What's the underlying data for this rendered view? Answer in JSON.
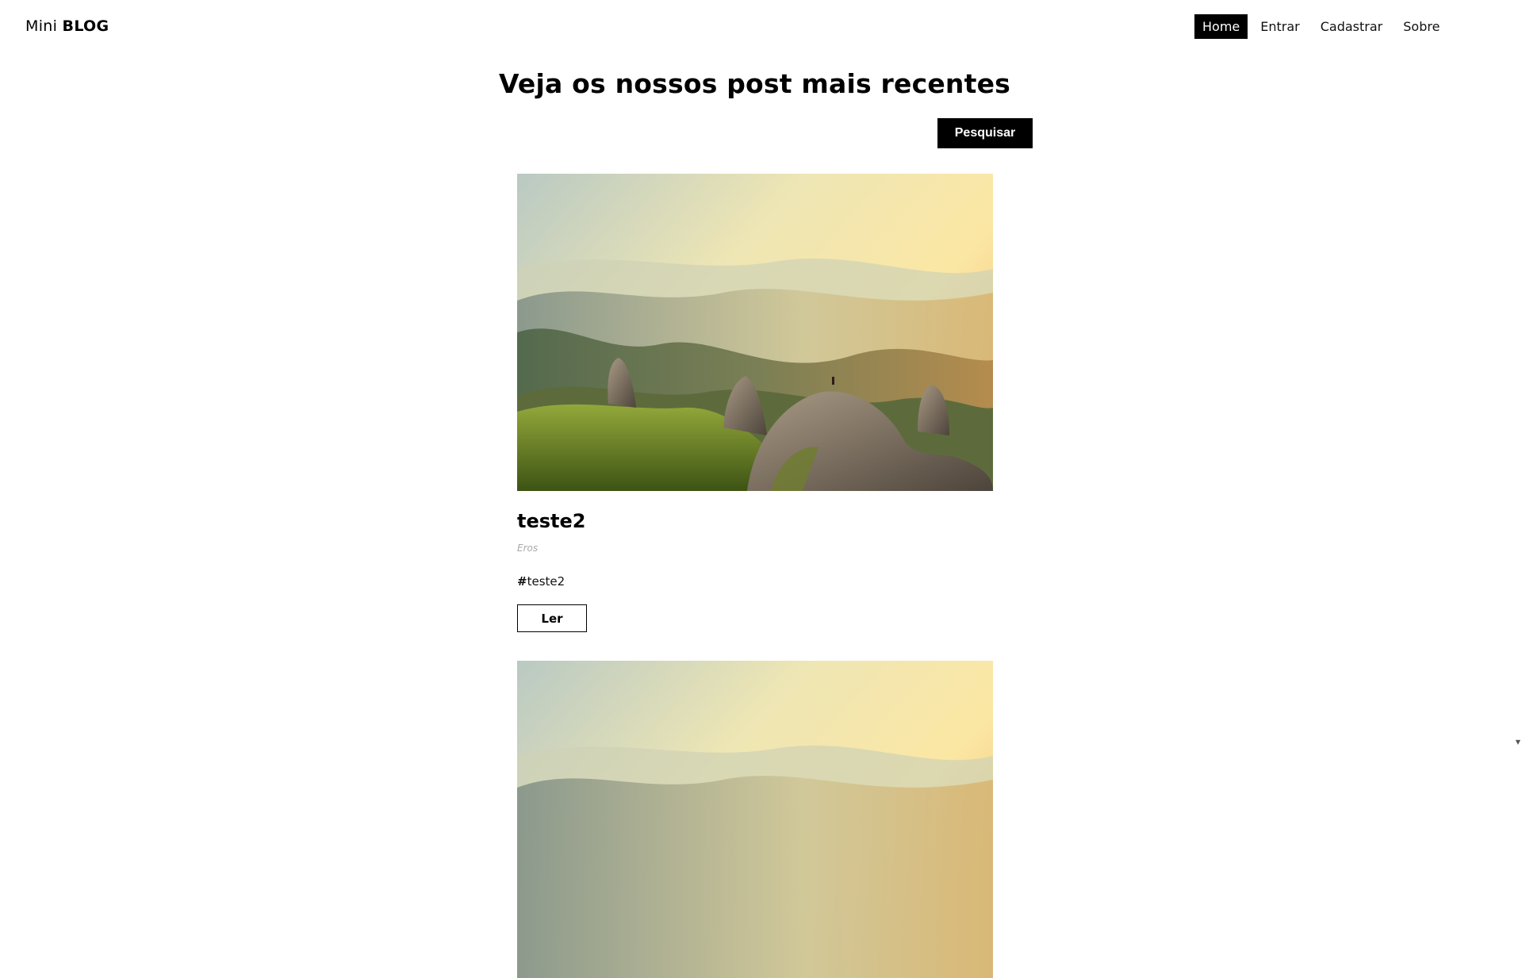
{
  "brand": {
    "light": "Mini",
    "bold": "BLOG"
  },
  "nav": {
    "items": [
      {
        "label": "Home",
        "active": true
      },
      {
        "label": "Entrar",
        "active": false
      },
      {
        "label": "Cadastrar",
        "active": false
      },
      {
        "label": "Sobre",
        "active": false
      }
    ]
  },
  "main": {
    "title": "Veja os nossos post mais recentes",
    "search": {
      "button_label": "Pesquisar",
      "value": "",
      "placeholder": ""
    }
  },
  "posts": [
    {
      "image_icon": "mountain-landscape-photo",
      "title": "teste2",
      "author": "Eros",
      "tag_hash": "#",
      "tag": "teste2",
      "read_label": "Ler"
    },
    {
      "image_icon": "mountain-landscape-photo"
    }
  ]
}
